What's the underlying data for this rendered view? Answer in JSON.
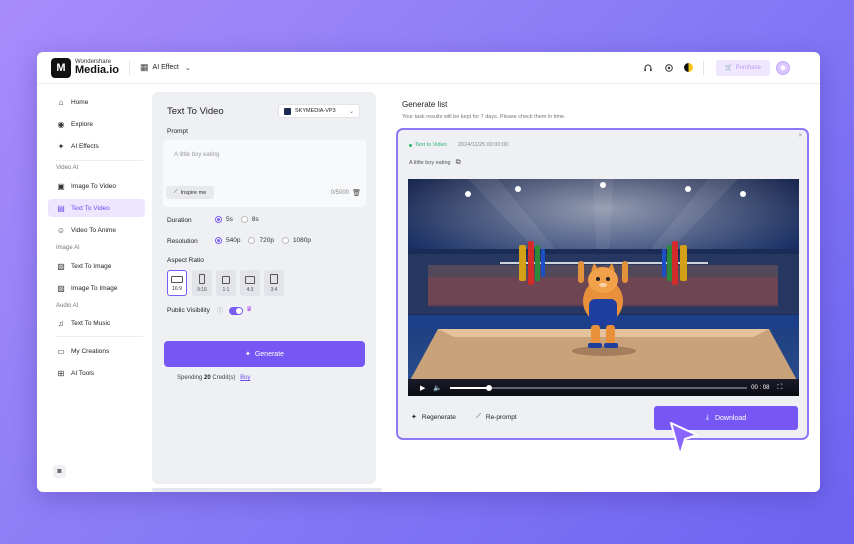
{
  "header": {
    "logo_top": "Wondershare",
    "logo_bottom": "Media.io",
    "effect_label": "AI Effect",
    "purchase_label": "Purchase",
    "icons": [
      "headset-icon",
      "settings-icon",
      "theme-icon",
      "avatar"
    ]
  },
  "sidebar": {
    "items": [
      {
        "label": "Home",
        "icon": "home-icon"
      },
      {
        "label": "Explore",
        "icon": "explore-icon"
      },
      {
        "label": "AI Effects",
        "icon": "sparkle-icon"
      },
      {
        "label": "Image To Video",
        "icon": "image-icon"
      },
      {
        "label": "Text To Video",
        "icon": "text-video-icon",
        "active": true
      },
      {
        "label": "Video To Anime",
        "icon": "anime-icon"
      },
      {
        "label": "Text To Image",
        "icon": "text-image-icon"
      },
      {
        "label": "Image To Image",
        "icon": "image-image-icon"
      },
      {
        "label": "Text To Music",
        "icon": "music-icon"
      },
      {
        "label": "My Creations",
        "icon": "folder-icon"
      },
      {
        "label": "AI Tools",
        "icon": "tools-icon"
      }
    ],
    "sections": [
      "Video AI",
      "Image AI",
      "Audio AI"
    ]
  },
  "panel": {
    "title": "Text To Video",
    "model": "SKYMEDIA-VP3",
    "prompt_label": "Prompt",
    "prompt_text": "A little boy eating",
    "inspire_label": "Inspire me",
    "char_count": "0/5000",
    "duration_label": "Duration",
    "durations": [
      "5s",
      "8s"
    ],
    "duration_selected": "5s",
    "resolution_label": "Resolution",
    "resolutions": [
      "540p",
      "720p",
      "1080p"
    ],
    "resolution_selected": "540p",
    "aspect_label": "Aspect Ratio",
    "aspects": [
      "16:9",
      "9:16",
      "1:1",
      "4:3",
      "3:4"
    ],
    "aspect_selected": "16:9",
    "visibility_label": "Public Visibility",
    "visibility_on": true,
    "generate_label": "Generate",
    "spending_prefix": "Spending",
    "spending_credits": "20",
    "spending_suffix": "Credit(s)",
    "buy_label": "Buy"
  },
  "results": {
    "title": "Generate list",
    "subtitle": "Your task results will be kept for 7 days. Please check them in time.",
    "tag": "Text to Video",
    "date": "2024/11/25  00:00:00",
    "prompt": "A little boy eating",
    "time": "00 : 08",
    "progress": 0.13,
    "regenerate_label": "Regenerate",
    "reprompt_label": "Re-prompt",
    "download_label": "Download",
    "accent": "#7657f5"
  }
}
